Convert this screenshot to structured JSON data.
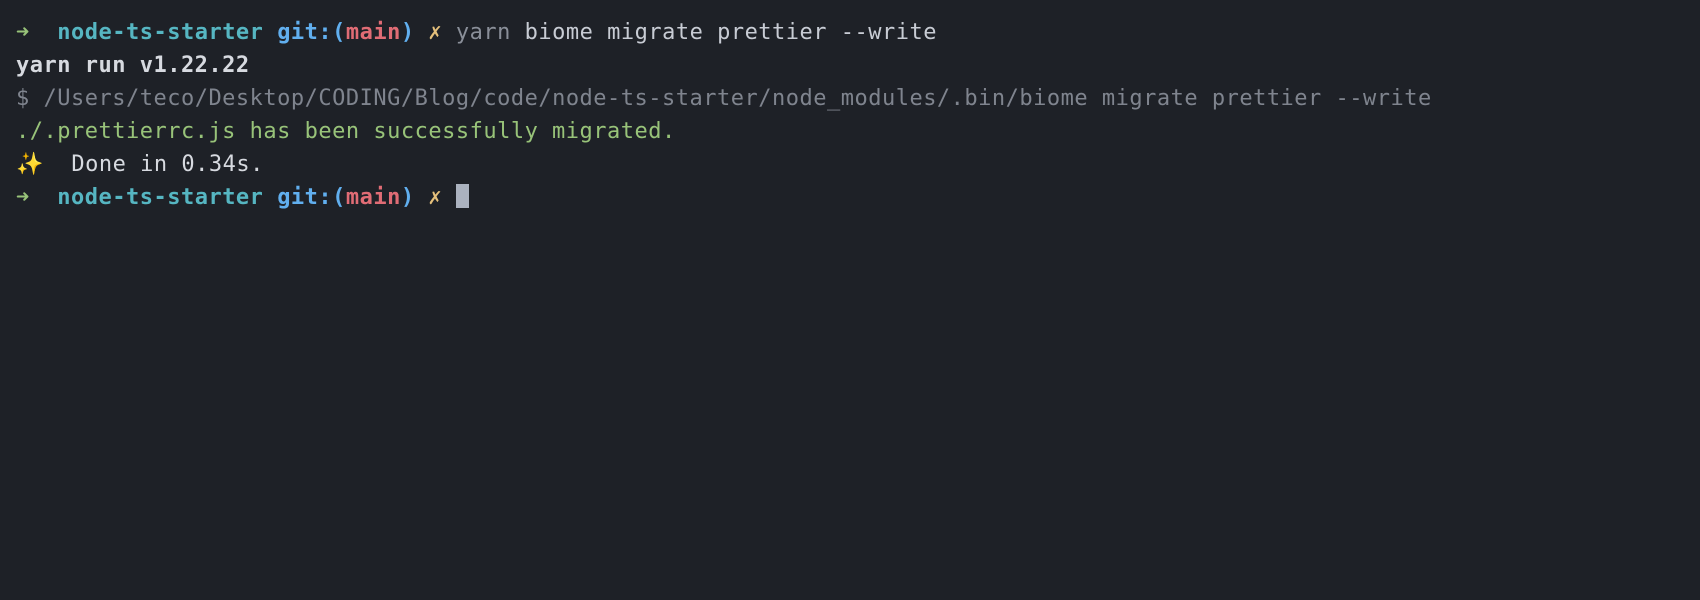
{
  "prompt1": {
    "arrow": "➜",
    "dir": "node-ts-starter",
    "git_label": "git:",
    "paren_open": "(",
    "branch": "main",
    "paren_close": ")",
    "dirty": "✗",
    "cmd_first": "yarn",
    "cmd_rest": "biome migrate prettier --write"
  },
  "yarn_version": "yarn run v1.22.22",
  "exec_line": {
    "prefix": "$ ",
    "path": "/Users/teco/Desktop/CODING/Blog/code/node-ts-starter/node_modules/.bin/biome migrate prettier --write"
  },
  "migration": {
    "file": "./.prettierrc.js",
    "message": " has been successfully migrated."
  },
  "done": {
    "sparkle": "✨",
    "text": "  Done in 0.34s."
  },
  "prompt2": {
    "arrow": "➜",
    "dir": "node-ts-starter",
    "git_label": "git:",
    "paren_open": "(",
    "branch": "main",
    "paren_close": ")",
    "dirty": "✗"
  }
}
